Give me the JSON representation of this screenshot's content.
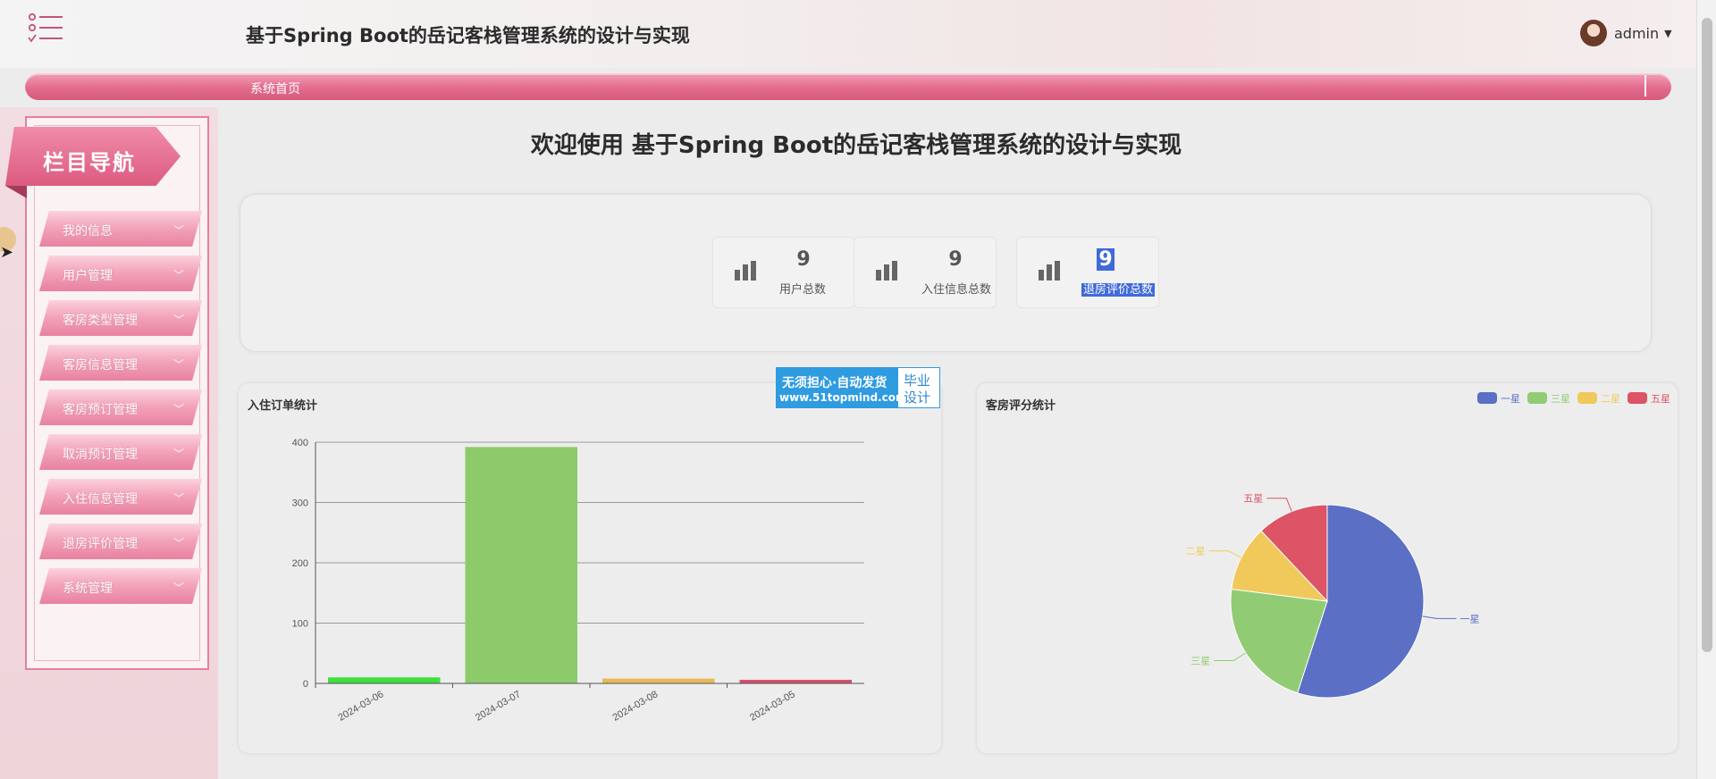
{
  "header": {
    "title": "基于Spring Boot的岳记客栈管理系统的设计与实现",
    "user": "admin"
  },
  "breadcrumb": {
    "current": "系统首页"
  },
  "sidebar": {
    "title": "栏目导航",
    "items": [
      {
        "label": "我的信息"
      },
      {
        "label": "用户管理"
      },
      {
        "label": "客房类型管理"
      },
      {
        "label": "客房信息管理"
      },
      {
        "label": "客房预订管理"
      },
      {
        "label": "取消预订管理"
      },
      {
        "label": "入住信息管理"
      },
      {
        "label": "退房评价管理"
      },
      {
        "label": "系统管理"
      }
    ]
  },
  "main": {
    "welcome": "欢迎使用 基于Spring Boot的岳记客栈管理系统的设计与实现",
    "stats": [
      {
        "value": "9",
        "label": "用户总数"
      },
      {
        "value": "9",
        "label": "入住信息总数"
      },
      {
        "value": "9",
        "label": "退房评价总数"
      }
    ]
  },
  "badge": {
    "line1": "无须担心·自动发货",
    "line2": "www.51topmind.com",
    "side1": "毕业",
    "side2": "设计"
  },
  "chart_data": [
    {
      "type": "bar",
      "title": "入住订单统计",
      "categories": [
        "2024-03-06",
        "2024-03-07",
        "2024-03-08",
        "2024-03-05"
      ],
      "values": [
        10,
        392,
        8,
        6
      ],
      "colors": [
        "#3ee03e",
        "#8dcb6a",
        "#e7b95a",
        "#d4516a"
      ],
      "ylim": [
        0,
        400
      ],
      "yticks": [
        0,
        100,
        200,
        300,
        400
      ]
    },
    {
      "type": "pie",
      "title": "客房评分统计",
      "labels": [
        "一星",
        "三星",
        "二星",
        "五星"
      ],
      "values": [
        55,
        22,
        11,
        12
      ],
      "colors": [
        "#5b6fc5",
        "#91cc75",
        "#f0c95a",
        "#dc5465"
      ],
      "legend_position": "top-right"
    }
  ]
}
